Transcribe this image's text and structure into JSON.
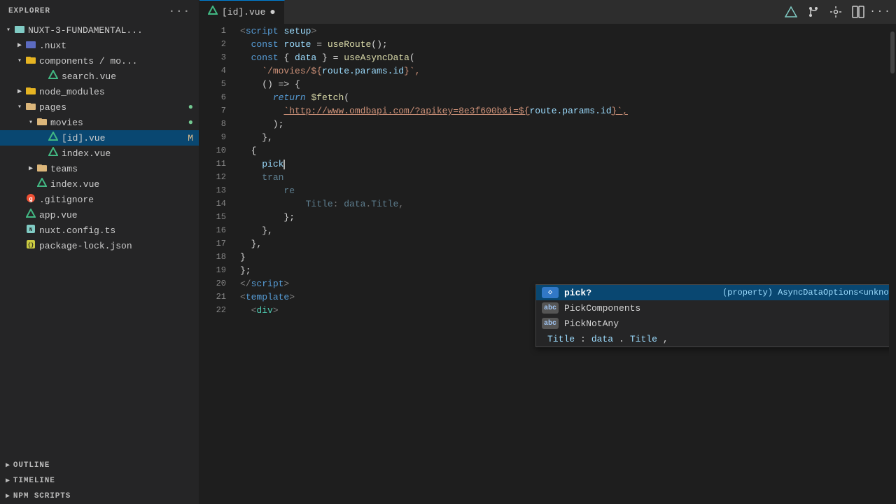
{
  "sidebar": {
    "title": "EXPLORER",
    "more_icon": "···",
    "root": {
      "label": "NUXT-3-FUNDAMENTAL...",
      "expanded": true,
      "children": [
        {
          "id": "nuxt",
          "label": ".nuxt",
          "type": "folder",
          "color": "nuxt",
          "expanded": false,
          "indent": 1
        },
        {
          "id": "components",
          "label": "components / mo...",
          "type": "folder",
          "color": "components",
          "expanded": true,
          "indent": 1
        },
        {
          "id": "search.vue",
          "label": "search.vue",
          "type": "vue",
          "indent": 2
        },
        {
          "id": "node_modules",
          "label": "node_modules",
          "type": "folder",
          "color": "node",
          "expanded": false,
          "indent": 1
        },
        {
          "id": "pages",
          "label": "pages",
          "type": "folder",
          "color": "pages",
          "expanded": true,
          "indent": 1,
          "badge": "●"
        },
        {
          "id": "movies",
          "label": "movies",
          "type": "folder",
          "color": "movies",
          "expanded": true,
          "indent": 2,
          "badge": "●"
        },
        {
          "id": "id.vue",
          "label": "[id].vue",
          "type": "vue",
          "indent": 3,
          "modified": "M",
          "selected": true
        },
        {
          "id": "index2.vue",
          "label": "index.vue",
          "type": "vue",
          "indent": 3
        },
        {
          "id": "teams",
          "label": "teams",
          "type": "folder",
          "color": "teams",
          "expanded": false,
          "indent": 2
        },
        {
          "id": "index.vue",
          "label": "index.vue",
          "type": "vue",
          "indent": 2
        },
        {
          "id": "gitignore",
          "label": ".gitignore",
          "type": "gitignore",
          "indent": 1
        },
        {
          "id": "app.vue",
          "label": "app.vue",
          "type": "vue",
          "indent": 1
        },
        {
          "id": "nuxt.config.ts",
          "label": "nuxt.config.ts",
          "type": "ts",
          "indent": 1
        },
        {
          "id": "package-lock.json",
          "label": "package-lock.json",
          "type": "json",
          "indent": 1
        }
      ]
    },
    "sections": [
      {
        "id": "outline",
        "label": "OUTLINE"
      },
      {
        "id": "timeline",
        "label": "TIMELINE"
      },
      {
        "id": "npm-scripts",
        "label": "NPM SCRIPTS"
      }
    ]
  },
  "tab": {
    "label": "[id].vue",
    "modified": "●",
    "modified_color": "#cccccc"
  },
  "toolbar": {
    "icons": [
      "mountain-icon",
      "split-icon",
      "branch-icon",
      "layout-icon",
      "more-icon"
    ]
  },
  "editor": {
    "lines": [
      {
        "num": 1,
        "tokens": [
          {
            "t": "<",
            "c": "tag-angle"
          },
          {
            "t": "script",
            "c": "kw"
          },
          {
            "t": " ",
            "c": "plain"
          },
          {
            "t": "setup",
            "c": "var"
          },
          {
            "t": ">",
            "c": "tag-angle"
          }
        ]
      },
      {
        "num": 2,
        "tokens": [
          {
            "t": "  ",
            "c": "plain"
          },
          {
            "t": "const",
            "c": "kw"
          },
          {
            "t": " ",
            "c": "plain"
          },
          {
            "t": "route",
            "c": "var"
          },
          {
            "t": " = ",
            "c": "plain"
          },
          {
            "t": "useRoute",
            "c": "fn"
          },
          {
            "t": "();",
            "c": "plain"
          }
        ]
      },
      {
        "num": 3,
        "tokens": [
          {
            "t": "  ",
            "c": "plain"
          },
          {
            "t": "const",
            "c": "kw"
          },
          {
            "t": " { ",
            "c": "plain"
          },
          {
            "t": "data",
            "c": "var"
          },
          {
            "t": " } = ",
            "c": "plain"
          },
          {
            "t": "useAsyncData",
            "c": "fn"
          },
          {
            "t": "(",
            "c": "plain"
          }
        ]
      },
      {
        "num": 4,
        "tokens": [
          {
            "t": "    ",
            "c": "plain"
          },
          {
            "t": "`/movies/${",
            "c": "str"
          },
          {
            "t": "route.params.id",
            "c": "var"
          },
          {
            "t": "}`,",
            "c": "str"
          }
        ]
      },
      {
        "num": 5,
        "tokens": [
          {
            "t": "    ",
            "c": "plain"
          },
          {
            "t": "()",
            "c": "plain"
          },
          {
            "t": " ⇒ ",
            "c": "plain"
          },
          {
            "t": "{",
            "c": "plain"
          }
        ]
      },
      {
        "num": 6,
        "tokens": [
          {
            "t": "      ",
            "c": "plain"
          },
          {
            "t": "return",
            "c": "kw-italic"
          },
          {
            "t": " ",
            "c": "plain"
          },
          {
            "t": "$fetch",
            "c": "fn"
          },
          {
            "t": "(",
            "c": "plain"
          }
        ]
      },
      {
        "num": 7,
        "tokens": [
          {
            "t": "        ",
            "c": "plain"
          },
          {
            "t": "`http://www.omdbapi.com/?apikey=8e3f600b&i=${",
            "c": "url"
          },
          {
            "t": "route.params.id",
            "c": "var"
          },
          {
            "t": "}`,",
            "c": "url"
          }
        ]
      },
      {
        "num": 8,
        "tokens": [
          {
            "t": "      ",
            "c": "plain"
          },
          {
            "t": ");",
            "c": "plain"
          }
        ]
      },
      {
        "num": 9,
        "tokens": [
          {
            "t": "    ",
            "c": "plain"
          },
          {
            "t": "},",
            "c": "plain"
          }
        ]
      },
      {
        "num": 10,
        "tokens": [
          {
            "t": "  {",
            "c": "plain"
          }
        ]
      },
      {
        "num": 11,
        "tokens": [
          {
            "t": "    ",
            "c": "plain"
          },
          {
            "t": "pick",
            "c": "var"
          },
          {
            "t": "CURSOR",
            "c": "cursor"
          }
        ]
      },
      {
        "num": 12,
        "tokens": [
          {
            "t": "    ",
            "c": "plain"
          },
          {
            "t": "tran",
            "c": "var"
          }
        ]
      },
      {
        "num": 13,
        "tokens": [
          {
            "t": "        ",
            "c": "plain"
          },
          {
            "t": "re",
            "c": "var"
          }
        ]
      },
      {
        "num": 14,
        "tokens": [
          {
            "t": "            ",
            "c": "plain"
          },
          {
            "t": "Title",
            "c": "prop"
          },
          {
            "t": ": ",
            "c": "plain"
          },
          {
            "t": "data",
            "c": "var"
          },
          {
            "t": ".",
            "c": "plain"
          },
          {
            "t": "Title",
            "c": "prop"
          },
          {
            "t": ",",
            "c": "plain"
          }
        ]
      },
      {
        "num": 15,
        "tokens": [
          {
            "t": "        ",
            "c": "plain"
          },
          {
            "t": "};",
            "c": "plain"
          }
        ]
      },
      {
        "num": 16,
        "tokens": [
          {
            "t": "    ",
            "c": "plain"
          },
          {
            "t": "},",
            "c": "plain"
          }
        ]
      },
      {
        "num": 17,
        "tokens": [
          {
            "t": "  },",
            "c": "plain"
          }
        ]
      },
      {
        "num": 18,
        "tokens": [
          {
            "t": "}",
            "c": "plain"
          }
        ]
      },
      {
        "num": 19,
        "tokens": [
          {
            "t": "};",
            "c": "plain"
          }
        ]
      },
      {
        "num": 20,
        "tokens": [
          {
            "t": "</",
            "c": "tag-angle"
          },
          {
            "t": "script",
            "c": "kw"
          },
          {
            "t": ">",
            "c": "tag-angle"
          }
        ]
      },
      {
        "num": 21,
        "tokens": [
          {
            "t": "<",
            "c": "tag-angle"
          },
          {
            "t": "template",
            "c": "kw"
          },
          {
            "t": ">",
            "c": "tag-angle"
          }
        ]
      },
      {
        "num": 22,
        "tokens": [
          {
            "t": "  ",
            "c": "plain"
          },
          {
            "t": "<",
            "c": "tag-angle"
          },
          {
            "t": "div",
            "c": "tag"
          },
          {
            "t": ">",
            "c": "tag-angle"
          }
        ]
      }
    ]
  },
  "autocomplete": {
    "items": [
      {
        "kind": "◇",
        "kind_class": "ac-kind-prop",
        "kind_label": "◇",
        "name": "pick?",
        "detail": "(property) AsyncDataOptions<unknown, _Transf…",
        "active": true
      },
      {
        "kind": "abc",
        "kind_class": "ac-kind-abc",
        "kind_label": "abc",
        "name": "PickComponents",
        "detail": "",
        "active": false
      },
      {
        "kind": "abc",
        "kind_class": "ac-kind-abc",
        "kind_label": "abc",
        "name": "PickNotAny",
        "detail": "",
        "active": false
      }
    ],
    "extra_line": "    Title: data.Title,"
  },
  "colors": {
    "accent_blue": "#007fd4",
    "selected_bg": "#094771",
    "sidebar_bg": "#252526",
    "editor_bg": "#1e1e1e",
    "tab_bg": "#2d2d2d"
  }
}
